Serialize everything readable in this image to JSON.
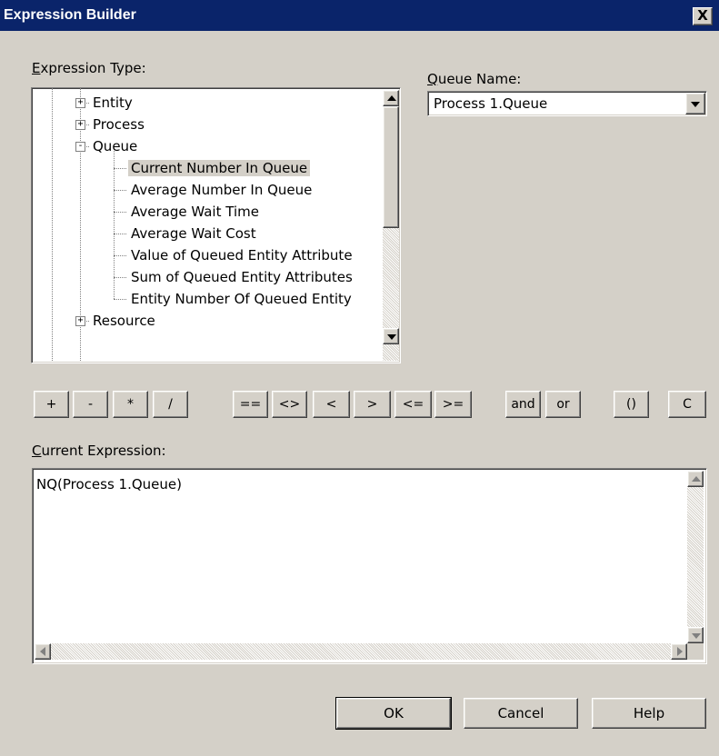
{
  "window": {
    "title": "Expression Builder",
    "close_glyph": "X"
  },
  "expression_type": {
    "label_accel": "E",
    "label_rest": "xpression Type:",
    "tree": [
      {
        "label": "Entity",
        "level": 1,
        "expander": "+"
      },
      {
        "label": "Process",
        "level": 1,
        "expander": "+"
      },
      {
        "label": "Queue",
        "level": 1,
        "expander": "-"
      },
      {
        "label": "Current Number In Queue",
        "level": 2,
        "selected": true
      },
      {
        "label": "Average Number In Queue",
        "level": 2
      },
      {
        "label": "Average Wait Time",
        "level": 2
      },
      {
        "label": "Average Wait Cost",
        "level": 2
      },
      {
        "label": "Value of Queued Entity Attribute",
        "level": 2
      },
      {
        "label": "Sum of Queued Entity Attributes",
        "level": 2
      },
      {
        "label": "Entity Number Of Queued Entity",
        "level": 2
      },
      {
        "label": "Resource",
        "level": 1,
        "expander": "+"
      }
    ]
  },
  "queue_name": {
    "label_accel": "Q",
    "label_rest": "ueue Name:",
    "value": "Process 1.Queue"
  },
  "operators": [
    "+",
    "-",
    "*",
    "/",
    "==",
    "<>",
    "<",
    ">",
    "<=",
    ">=",
    "and",
    "or",
    "()",
    "C"
  ],
  "current_expression": {
    "label_accel": "C",
    "label_rest": "urrent Expression:",
    "value": "NQ(Process 1.Queue)"
  },
  "buttons": {
    "ok": "OK",
    "cancel": "Cancel",
    "help_accel": "H",
    "help_rest": "elp"
  },
  "colors": {
    "titlebar": "#0a246a",
    "dialog_face": "#d4d0c8",
    "selection_highlight": "#d4d0c8"
  }
}
